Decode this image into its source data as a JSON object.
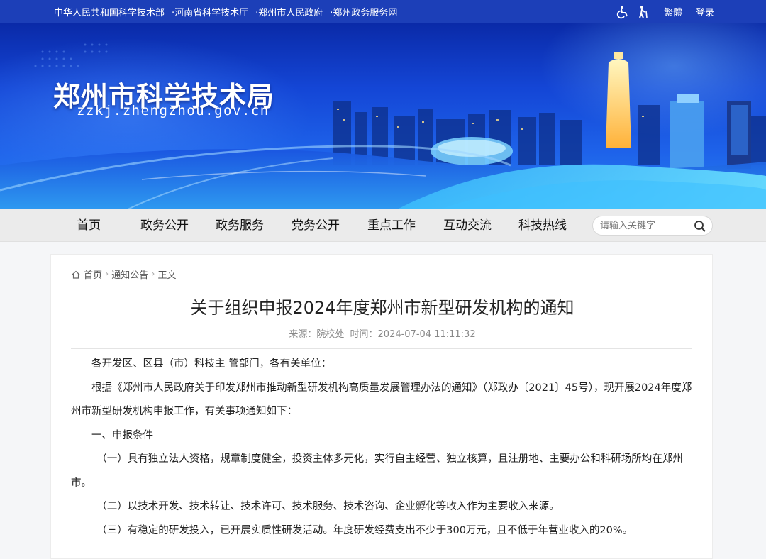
{
  "topbar": {
    "links": [
      "中华人民共和国科学技术部",
      "·河南省科学技术厅",
      "·郑州市人民政府",
      "·郑州政务服务网"
    ],
    "traditional": "繁體",
    "login": "登录"
  },
  "banner": {
    "title": "郑州市科学技术局",
    "domain": "zzkj.zhengzhou.gov.cn"
  },
  "nav": {
    "items": [
      "首页",
      "政务公开",
      "政务服务",
      "党务公开",
      "重点工作",
      "互动交流",
      "科技热线"
    ],
    "search_placeholder": "请输入关键字"
  },
  "breadcrumb": [
    "首页",
    "通知公告",
    "正文"
  ],
  "article": {
    "title": "关于组织申报2024年度郑州市新型研发机构的通知",
    "source_label": "来源：院校处",
    "time_label": "时间：2024-07-04 11:11:32",
    "paragraphs": [
      "各开发区、区县（市）科技主 管部门，各有关单位：",
      "根据《郑州市人民政府关于印发郑州市推动新型研发机构高质量发展管理办法的通知》（郑政办〔2021〕45号），现开展2024年度郑州市新型研发机构申报工作，有关事项通知如下：",
      "一、申报条件",
      "（一）具有独立法人资格，规章制度健全，投资主体多元化，实行自主经营、独立核算，且注册地、主要办公和科研场所均在郑州市。",
      "（二）以技术开发、技术转让、技术许可、技术服务、技术咨询、企业孵化等收入作为主要收入来源。",
      "（三）有稳定的研发投入，已开展实质性研发活动。年度研发经费支出不少于300万元，且不低于年营业收入的20%。"
    ]
  }
}
